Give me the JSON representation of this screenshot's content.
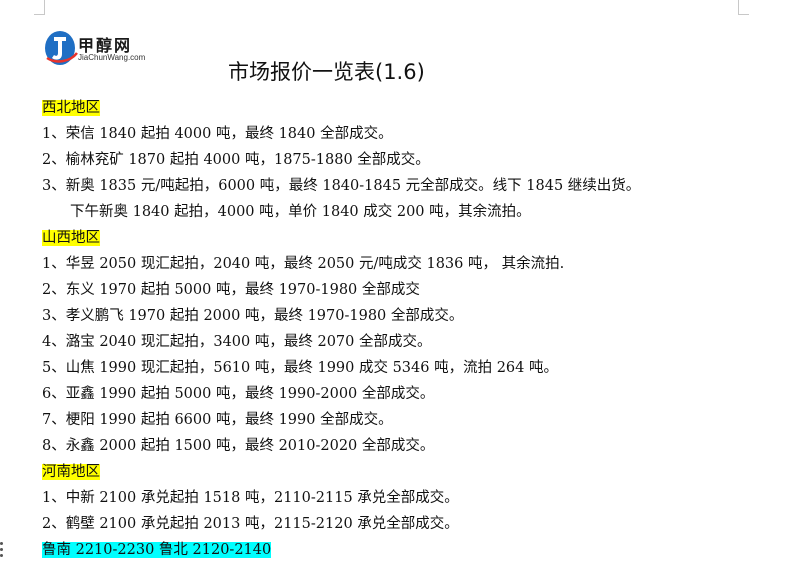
{
  "logo": {
    "cn": "甲醇网",
    "en": "JiaChunWang.com"
  },
  "title": "市场报价一览表(1.6)",
  "lines": [
    {
      "text": "西北地区",
      "type": "section",
      "highlight": "#ffff00"
    },
    {
      "text": "1、荣信 1840 起拍 4000 吨，最终 1840 全部成交。",
      "type": "item"
    },
    {
      "text": "2、榆林兖矿 1870 起拍 4000 吨，1875-1880 全部成交。",
      "type": "item"
    },
    {
      "text": "3、新奥 1835 元/吨起拍，6000 吨，最终 1840-1845 元全部成交。线下 1845 继续出货。",
      "type": "item"
    },
    {
      "text": "下午新奥 1840 起拍，4000 吨，单价 1840 成交 200 吨，其余流拍。",
      "type": "indent"
    },
    {
      "text": "山西地区",
      "type": "section",
      "highlight": "#ffff00"
    },
    {
      "text": "1、华昱 2050 现汇起拍，2040 吨，最终 2050 元/吨成交 1836 吨，  其余流拍.",
      "type": "item"
    },
    {
      "text": "2、东义 1970 起拍 5000 吨，最终 1970-1980 全部成交",
      "type": "item"
    },
    {
      "text": "3、孝义鹏飞 1970 起拍 2000 吨，最终 1970-1980 全部成交。",
      "type": "item"
    },
    {
      "text": "4、潞宝 2040 现汇起拍，3400 吨，最终 2070 全部成交。",
      "type": "item"
    },
    {
      "text": "5、山焦 1990 现汇起拍，5610 吨，最终 1990 成交 5346 吨，流拍 264 吨。",
      "type": "item"
    },
    {
      "text": "6、亚鑫 1990 起拍 5000 吨，最终 1990-2000 全部成交。",
      "type": "item"
    },
    {
      "text": "7、梗阳 1990 起拍 6600 吨，最终 1990 全部成交。",
      "type": "item"
    },
    {
      "text": "8、永鑫 2000 起拍 1500 吨，最终 2010-2020 全部成交。",
      "type": "item"
    },
    {
      "text": "河南地区",
      "type": "section",
      "highlight": "#ffff00"
    },
    {
      "text": "1、中新 2100 承兑起拍 1518 吨，2110-2115 承兑全部成交。",
      "type": "item"
    },
    {
      "text": "2、鹤壁 2100 承兑起拍 2013 吨，2115-2120 承兑全部成交。",
      "type": "item"
    },
    {
      "text": "鲁南 2210-2230 鲁北 2120-2140",
      "type": "section",
      "highlight": "#00ffff"
    }
  ],
  "colors": {
    "yellow_highlight": "#ffff00",
    "cyan_highlight": "#00ffff",
    "logo_blue": "#1f6fc4"
  }
}
